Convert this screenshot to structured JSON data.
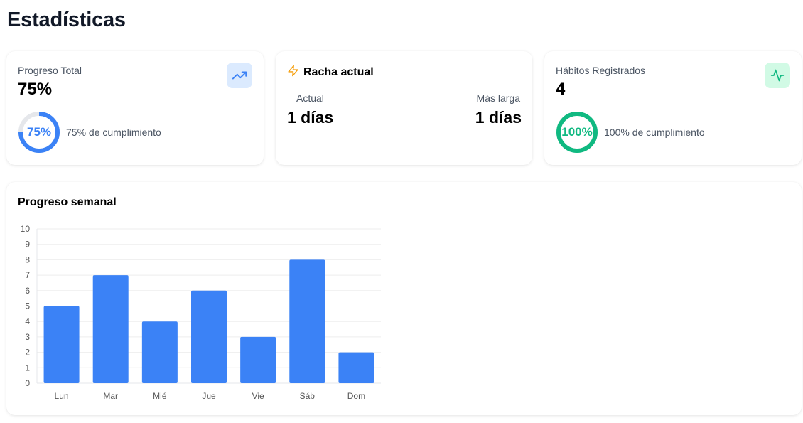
{
  "page": {
    "title": "Estadísticas"
  },
  "progress_card": {
    "label": "Progreso Total",
    "value": "75%",
    "ring_percent": 75,
    "ring_text": "75%",
    "caption": "75% de cumplimiento",
    "icon": "trending-up-icon",
    "color": "#3b82f6",
    "icon_bg": "#dbeafe"
  },
  "streak_card": {
    "title": "Racha actual",
    "icon": "lightning-icon",
    "icon_color": "#f59e0b",
    "current_label": "Actual",
    "current_value": "1 días",
    "longest_label": "Más larga",
    "longest_value": "1 días"
  },
  "habits_card": {
    "label": "Hábitos Registrados",
    "value": "4",
    "ring_percent": 100,
    "ring_text": "100%",
    "caption": "100% de cumplimiento",
    "icon": "activity-icon",
    "color": "#10b981",
    "icon_bg": "#d1fae5"
  },
  "weekly": {
    "title": "Progreso semanal"
  },
  "chart_data": {
    "type": "bar",
    "categories": [
      "Lun",
      "Mar",
      "Mié",
      "Jue",
      "Vie",
      "Sáb",
      "Dom"
    ],
    "values": [
      5,
      7,
      4,
      6,
      3,
      8,
      2
    ],
    "ylim": [
      0,
      10
    ],
    "yticks": [
      0,
      1,
      2,
      3,
      4,
      5,
      6,
      7,
      8,
      9,
      10
    ],
    "grid": true,
    "bar_color": "#3b82f6",
    "title": "",
    "xlabel": "",
    "ylabel": ""
  }
}
